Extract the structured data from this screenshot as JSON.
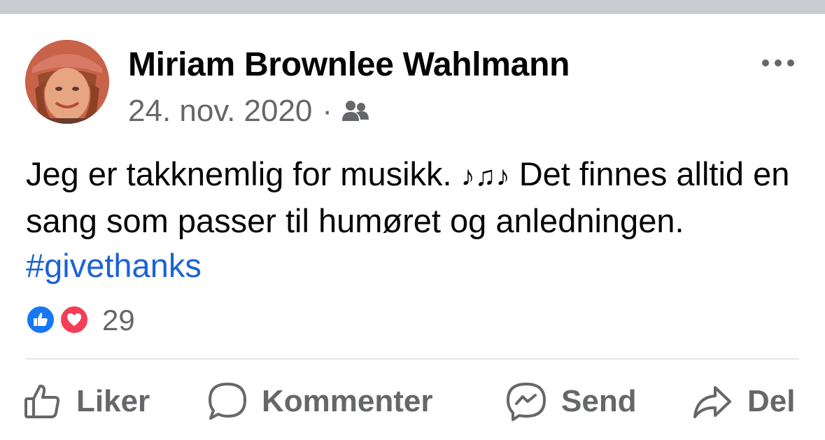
{
  "post": {
    "author_name": "Miriam Brownlee Wahlmann",
    "date": "24. nov. 2020",
    "separator": "·",
    "audience_icon": "friends-icon",
    "more_icon": "more-dots-icon",
    "text_part1": "Jeg er takknemlig for musikk. ",
    "notes_emoji": "♪♫♪",
    "text_part2": " Det finnes alltid en sang som passer til humøret og anledningen. ",
    "hashtag": "#givethanks"
  },
  "reactions": {
    "types": [
      "like",
      "love"
    ],
    "count": "29"
  },
  "actions": {
    "like_label": "Liker",
    "comment_label": "Kommenter",
    "send_label": "Send",
    "share_label": "Del"
  },
  "colors": {
    "text": "#050505",
    "secondary": "#65676b",
    "hashtag": "#1b63d6",
    "like_blue": "#1877f2",
    "love_red": "#f33e58",
    "divider": "#e4e6eb"
  }
}
